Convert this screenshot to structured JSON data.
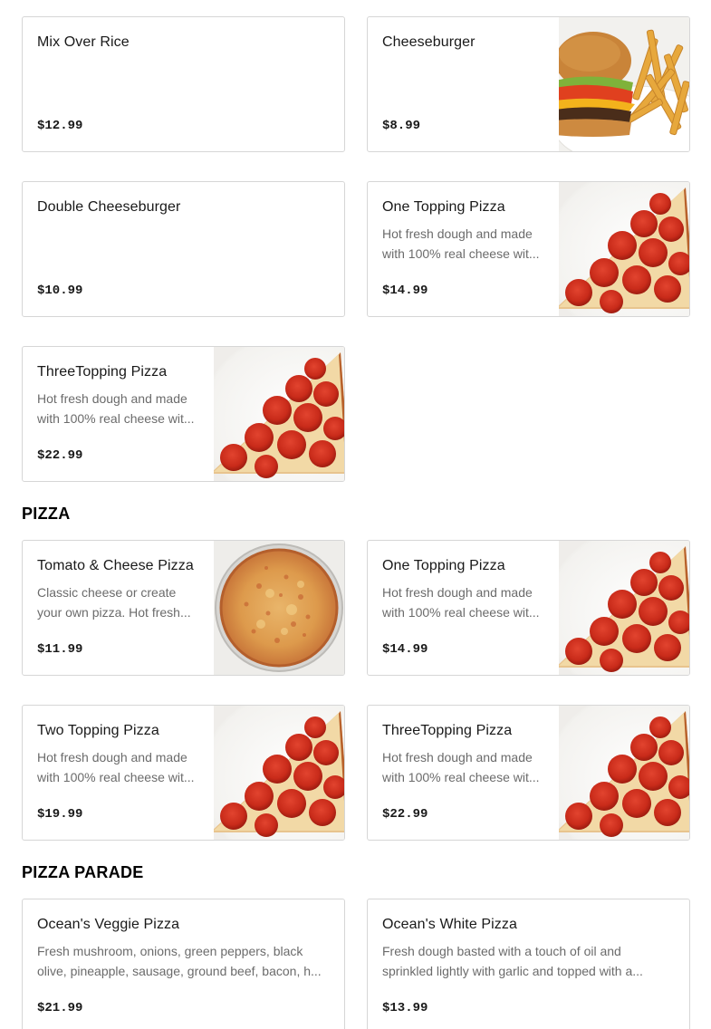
{
  "sections": [
    {
      "title": "",
      "items": [
        {
          "name": "Mix Over Rice",
          "description": "",
          "price": "$12.99",
          "image": "none"
        },
        {
          "name": "Cheeseburger",
          "description": "",
          "price": "$8.99",
          "image": "cheeseburger-photo"
        },
        {
          "name": "Double Cheeseburger",
          "description": "",
          "price": "$10.99",
          "image": "none"
        },
        {
          "name": "One Topping Pizza",
          "description": "Hot fresh dough and made with 100% real cheese wit...",
          "price": "$14.99",
          "image": "pepperoni-slice-photo"
        },
        {
          "name": "ThreeTopping Pizza",
          "description": "Hot fresh dough and made with 100% real cheese wit...",
          "price": "$22.99",
          "image": "pepperoni-slice-photo"
        }
      ]
    },
    {
      "title": "PIZZA",
      "items": [
        {
          "name": "Tomato & Cheese Pizza",
          "description": "Classic cheese or create your own pizza. Hot fresh...",
          "price": "$11.99",
          "image": "cheese-pizza-photo"
        },
        {
          "name": "One Topping Pizza",
          "description": "Hot fresh dough and made with 100% real cheese wit...",
          "price": "$14.99",
          "image": "pepperoni-slice-photo"
        },
        {
          "name": "Two Topping Pizza",
          "description": "Hot fresh dough and made with 100% real cheese wit...",
          "price": "$19.99",
          "image": "pepperoni-slice-photo"
        },
        {
          "name": "ThreeTopping Pizza",
          "description": "Hot fresh dough and made with 100% real cheese wit...",
          "price": "$22.99",
          "image": "pepperoni-slice-photo"
        }
      ]
    },
    {
      "title": "PIZZA PARADE",
      "items": [
        {
          "name": "Ocean's Veggie Pizza",
          "description": "Fresh mushroom, onions, green peppers, black olive, pineapple, sausage, ground beef, bacon, h...",
          "price": "$21.99",
          "image": "none"
        },
        {
          "name": "Ocean's White Pizza",
          "description": "Fresh dough basted with a touch of oil and sprinkled lightly with garlic and topped with a...",
          "price": "$13.99",
          "image": "none"
        }
      ]
    }
  ]
}
